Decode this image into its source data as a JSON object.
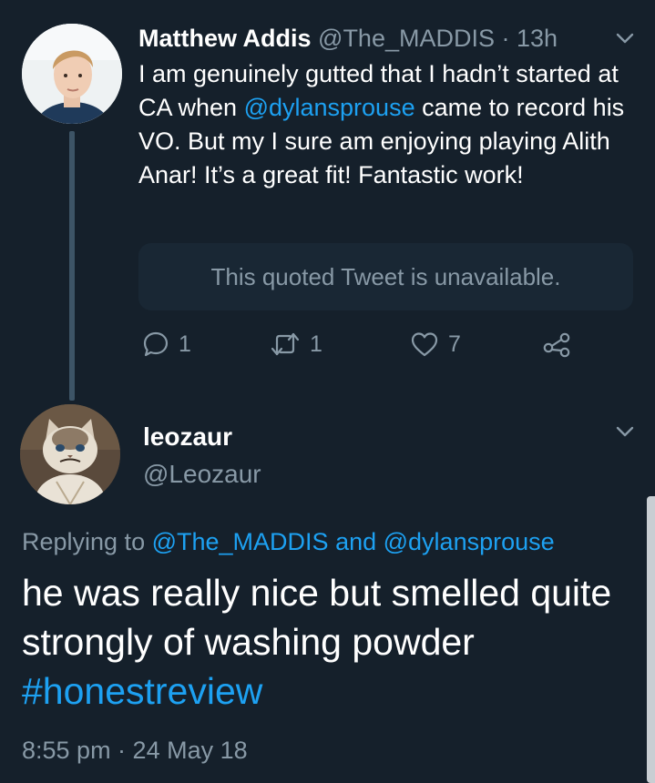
{
  "tweet1": {
    "name": "Matthew Addis",
    "handle": "@The_MADDIS",
    "separator": " · ",
    "time": "13h",
    "text_part1": "I am genuinely gutted that I hadn’t started at CA when ",
    "mention": "@dylansprouse",
    "text_part2": " came to record his VO. But my I sure am enjoying playing Alith Anar! It’s a great fit! Fantastic work!",
    "quote_unavailable": "This quoted Tweet is unavailable.",
    "actions": {
      "reply_count": "1",
      "retweet_count": "1",
      "like_count": "7"
    }
  },
  "tweet2": {
    "name": "leozaur",
    "handle": "@Leozaur",
    "replying_prefix": "Replying to ",
    "replying_user1": "@The_MADDIS",
    "replying_and": " and ",
    "replying_user2": "@dylansprouse",
    "text": "he was really nice but smelled quite strongly of washing powder ",
    "hashtag": "#honestreview",
    "timestamp": "8:55 pm · 24 May 18"
  },
  "colors": {
    "background": "#15202b",
    "text": "#ffffff",
    "muted": "#8899a6",
    "link": "#1da1f2",
    "quote_bg": "#192734",
    "thread_line": "#3d5466"
  },
  "icons": {
    "reply": "speech-bubble-icon",
    "retweet": "retweet-arrows-icon",
    "like": "heart-icon",
    "share": "share-nodes-icon",
    "more": "chevron-down-icon"
  }
}
